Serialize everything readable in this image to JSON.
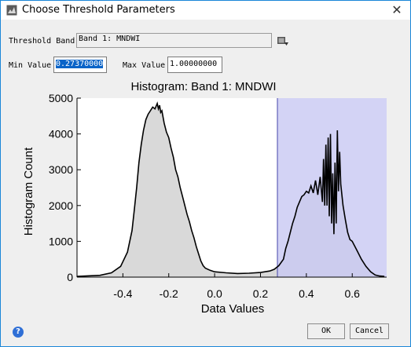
{
  "window": {
    "title": "Choose Threshold Parameters",
    "close_glyph": "✕"
  },
  "threshold_band": {
    "label": "Threshold Band",
    "value": "Band 1: MNDWI"
  },
  "min_value": {
    "label": "Min Value",
    "value": "0.27370000"
  },
  "max_value": {
    "label": "Max Value",
    "value": "1.00000000"
  },
  "buttons": {
    "ok": "OK",
    "cancel": "Cancel",
    "help_glyph": "?"
  },
  "colors": {
    "fill_gray": "#d9d9d9",
    "selection_band": "#c8c8f2",
    "selection_line": "#4646aa",
    "selected_text_bg": "#0a64c8"
  },
  "chart_data": {
    "type": "area",
    "title": "Histogram: Band 1: MNDWI",
    "xlabel": "Data Values",
    "ylabel": "Histogram Count",
    "xlim": [
      -0.6,
      0.75
    ],
    "ylim": [
      0,
      5000
    ],
    "x_ticks": [
      "-0.4",
      "-0.2",
      "0.0",
      "0.2",
      "0.4",
      "0.6"
    ],
    "x_tick_values": [
      -0.4,
      -0.2,
      0.0,
      0.2,
      0.4,
      0.6
    ],
    "y_ticks": [
      "0",
      "1000",
      "2000",
      "3000",
      "4000",
      "5000"
    ],
    "y_tick_values": [
      0,
      1000,
      2000,
      3000,
      4000,
      5000
    ],
    "selected_range": [
      0.2737,
      0.75
    ],
    "series": [
      {
        "x": [
          -0.6,
          -0.5,
          -0.45,
          -0.41,
          -0.38,
          -0.36,
          -0.35,
          -0.34,
          -0.33,
          -0.32,
          -0.31,
          -0.3,
          -0.29,
          -0.28,
          -0.27,
          -0.26,
          -0.25,
          -0.245,
          -0.24,
          -0.235,
          -0.23,
          -0.22,
          -0.21,
          -0.2,
          -0.19,
          -0.18,
          -0.17,
          -0.16,
          -0.15,
          -0.14,
          -0.13,
          -0.12,
          -0.11,
          -0.1,
          -0.09,
          -0.08,
          -0.07,
          -0.06,
          -0.05,
          -0.04,
          -0.02,
          0.0,
          0.05,
          0.1,
          0.15,
          0.2,
          0.24,
          0.26,
          0.28,
          0.3,
          0.31,
          0.32,
          0.33,
          0.34,
          0.35,
          0.36,
          0.37,
          0.38,
          0.39,
          0.4,
          0.41,
          0.42,
          0.43,
          0.44,
          0.45,
          0.46,
          0.47,
          0.475,
          0.48,
          0.485,
          0.49,
          0.495,
          0.5,
          0.505,
          0.51,
          0.515,
          0.52,
          0.525,
          0.53,
          0.535,
          0.54,
          0.545,
          0.55,
          0.56,
          0.57,
          0.58,
          0.59,
          0.6,
          0.62,
          0.64,
          0.66,
          0.68,
          0.7,
          0.72,
          0.74
        ],
        "values": [
          20,
          50,
          120,
          300,
          700,
          1300,
          1900,
          2500,
          3200,
          3700,
          4100,
          4400,
          4550,
          4650,
          4750,
          4700,
          4850,
          4700,
          4800,
          4600,
          4650,
          4300,
          4050,
          3900,
          3600,
          3350,
          3000,
          2800,
          2500,
          2250,
          2000,
          1750,
          1550,
          1300,
          1100,
          850,
          650,
          450,
          320,
          250,
          190,
          150,
          120,
          100,
          110,
          130,
          170,
          220,
          320,
          500,
          800,
          1000,
          1250,
          1500,
          1700,
          1950,
          2100,
          2250,
          2300,
          2400,
          2350,
          2550,
          2350,
          2700,
          2300,
          2800,
          2100,
          3300,
          2000,
          3700,
          2000,
          3900,
          1700,
          4000,
          1500,
          2900,
          1200,
          3200,
          1500,
          4100,
          2400,
          3500,
          2600,
          2000,
          1600,
          1250,
          1050,
          1000,
          750,
          500,
          300,
          150,
          60,
          30,
          20
        ]
      }
    ]
  }
}
